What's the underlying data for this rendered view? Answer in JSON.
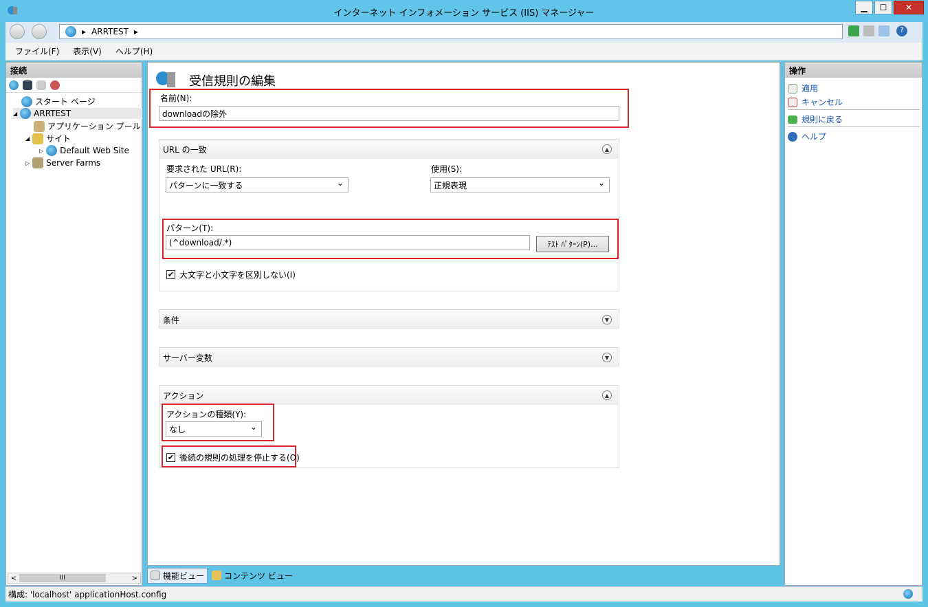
{
  "window": {
    "title": "インターネット インフォメーション サービス (IIS) マネージャー",
    "minimize": "▁",
    "maximize": "☐",
    "close": "✕"
  },
  "nav": {
    "address_separator": "▸",
    "address_item": "ARRTEST",
    "address_trailing": "▸"
  },
  "menu": {
    "file": "ファイル(F)",
    "view": "表示(V)",
    "help": "ヘルプ(H)"
  },
  "connections": {
    "header": "接続",
    "tree": [
      {
        "label": "スタート ページ"
      },
      {
        "label": "ARRTEST"
      },
      {
        "label": "アプリケーション プール"
      },
      {
        "label": "サイト"
      },
      {
        "label": "Default Web Site"
      },
      {
        "label": "Server Farms"
      }
    ],
    "scroll_thumb": "III"
  },
  "main": {
    "title": "受信規則の編集",
    "name_label": "名前(N):",
    "name_value": "downloadの除外",
    "url_match": {
      "header": "URL の一致",
      "requested_url_label": "要求された URL(R):",
      "requested_url_value": "パターンに一致する",
      "using_label": "使用(S):",
      "using_value": "正規表現",
      "pattern_label": "パターン(T):",
      "pattern_value": "(^download/.*)",
      "test_button": "ﾃｽﾄ ﾊﾟﾀｰﾝ(P)...",
      "ignore_case_label": "大文字と小文字を区別しない(I)",
      "ignore_case_checked": true
    },
    "conditions": {
      "header": "条件"
    },
    "server_variables": {
      "header": "サーバー変数"
    },
    "action": {
      "header": "アクション",
      "type_label": "アクションの種類(Y):",
      "type_value": "なし",
      "stop_processing_label": "後続の規則の処理を停止する(O)",
      "stop_processing_checked": true
    }
  },
  "tabs": {
    "features": "機能ビュー",
    "content": "コンテンツ ビュー"
  },
  "actions": {
    "header": "操作",
    "apply": "適用",
    "cancel": "キャンセル",
    "back": "規則に戻る",
    "help": "ヘルプ"
  },
  "status": {
    "text": "構成: 'localhost' applicationHost.config"
  },
  "colors": {
    "titlebar": "#62c4e8",
    "highlight_red": "#d9262c",
    "link_blue": "#1a56b0"
  }
}
